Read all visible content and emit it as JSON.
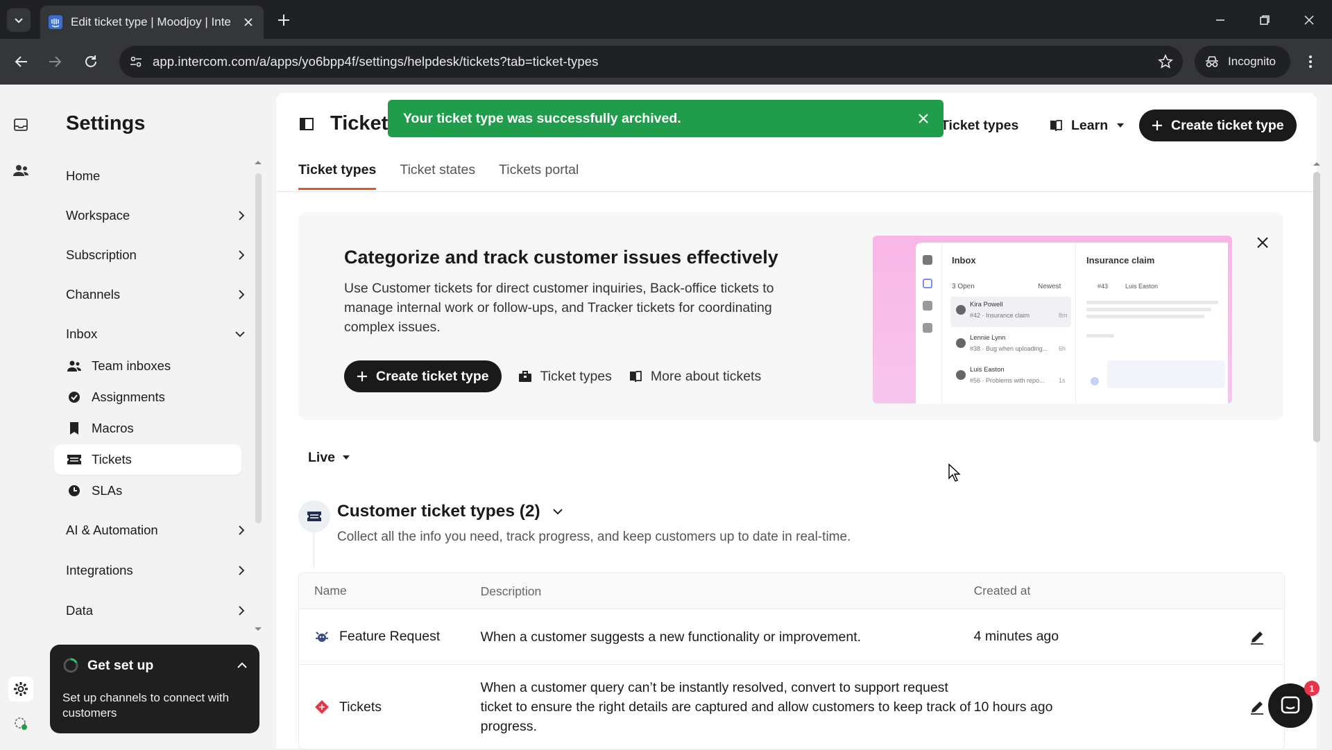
{
  "browser": {
    "tab_title": "Edit ticket type | Moodjoy | Inte",
    "url": "app.intercom.com/a/apps/yo6bpp4f/settings/helpdesk/tickets?tab=ticket-types",
    "incognito_label": "Incognito"
  },
  "sidebar": {
    "title": "Settings",
    "items": [
      {
        "label": "Home"
      },
      {
        "label": "Workspace"
      },
      {
        "label": "Subscription"
      },
      {
        "label": "Channels"
      },
      {
        "label": "Inbox"
      },
      {
        "label": "AI & Automation"
      },
      {
        "label": "Integrations"
      },
      {
        "label": "Data"
      }
    ],
    "inbox_sub": [
      {
        "label": "Team inboxes",
        "icon": "team-icon"
      },
      {
        "label": "Assignments",
        "icon": "assignment-icon"
      },
      {
        "label": "Macros",
        "icon": "bookmark-icon"
      },
      {
        "label": "Tickets",
        "icon": "ticket-icon",
        "active": true
      },
      {
        "label": "SLAs",
        "icon": "clock-icon"
      }
    ]
  },
  "setup": {
    "title": "Get set up",
    "desc": "Set up channels to connect with customers"
  },
  "header": {
    "title": "Tickets",
    "ticket_types_btn": "Ticket types",
    "learn_btn": "Learn",
    "create_btn": "Create ticket type"
  },
  "toast": {
    "message": "Your ticket type was successfully archived."
  },
  "tabs": [
    "Ticket types",
    "Ticket states",
    "Tickets portal"
  ],
  "banner": {
    "title": "Categorize and track customer issues effectively",
    "desc": "Use Customer tickets for direct customer inquiries, Back-office tickets to manage internal work or follow-ups, and Tracker tickets for coordinating complex issues.",
    "create_btn": "Create ticket type",
    "ticket_types_link": "Ticket types",
    "more_link": "More about tickets",
    "preview": {
      "inbox": "Inbox",
      "claim": "Insurance claim",
      "open": "3 Open",
      "newest": "Newest",
      "ticket_no": "#43",
      "assignee": "Luis Easton",
      "rows": [
        {
          "name": "Kira Powell",
          "sub": "#42 · Insurance claim",
          "time": "8m"
        },
        {
          "name": "Lennie Lynn",
          "sub": "#38 · Bug when uploading...",
          "time": "6h"
        },
        {
          "name": "Luis Easton",
          "sub": "#56 · Problems with repo...",
          "time": "1s"
        }
      ]
    }
  },
  "filter": {
    "label": "Live"
  },
  "section": {
    "title": "Customer ticket types (2)",
    "desc": "Collect all the info you need, track progress, and keep customers up to date in real-time."
  },
  "table": {
    "headers": [
      "Name",
      "Description",
      "Created at"
    ],
    "rows": [
      {
        "name": "Feature Request",
        "desc": "When a customer suggests a new functionality or improvement.",
        "created": "4 minutes ago"
      },
      {
        "name": "Tickets",
        "desc": "When a customer query can’t be instantly resolved, convert to support request ticket to ensure the right details are captured and allow customers to keep track of progress.",
        "created": "10 hours ago"
      }
    ]
  },
  "messenger_badge": "1",
  "colors": {
    "accent": "#e0581d",
    "success": "#1f9d4a",
    "dark": "#1a1a1a"
  }
}
